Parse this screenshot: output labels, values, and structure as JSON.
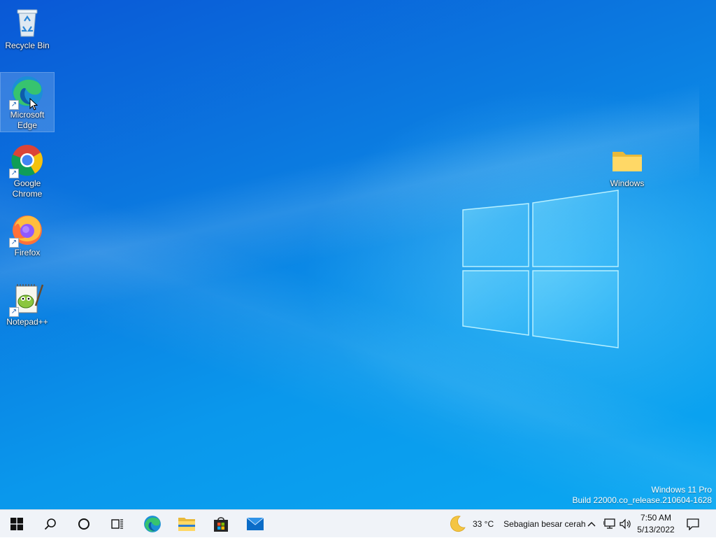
{
  "desktop_icons": [
    {
      "label": "Recycle Bin",
      "icon": "recycle-bin-icon"
    },
    {
      "label": "Microsoft Edge",
      "icon": "edge-icon",
      "selected": true
    },
    {
      "label": "Google Chrome",
      "icon": "chrome-icon"
    },
    {
      "label": "Firefox",
      "icon": "firefox-icon"
    },
    {
      "label": "Notepad++",
      "icon": "notepad-plus-plus-icon"
    },
    {
      "label": "Windows",
      "icon": "folder-icon"
    }
  ],
  "watermark": {
    "line1": "Windows 11 Pro",
    "line2": "Build 22000.co_release.210604-1628"
  },
  "taskbar": {
    "items": [
      {
        "icon": "start-icon"
      },
      {
        "icon": "search-icon"
      },
      {
        "icon": "cortana-icon"
      },
      {
        "icon": "task-view-icon"
      },
      {
        "icon": "edge-icon"
      },
      {
        "icon": "file-explorer-icon"
      },
      {
        "icon": "microsoft-store-icon"
      },
      {
        "icon": "mail-icon"
      }
    ],
    "weather": {
      "icon": "moon-icon",
      "temperature": "33 °C",
      "condition": "Sebagian besar cerah"
    },
    "tray": [
      "chevron-up-icon",
      "network-icon",
      "volume-icon"
    ],
    "clock": {
      "time": "7:50 AM",
      "date": "5/13/2022"
    },
    "notification_icon": "action-center-icon"
  },
  "colors": {
    "desktop_top": "#0a58d6",
    "desktop_bottom": "#0aa8f2",
    "taskbar_bg": "#f0f3f8",
    "accent_blue": "#0078d4"
  }
}
